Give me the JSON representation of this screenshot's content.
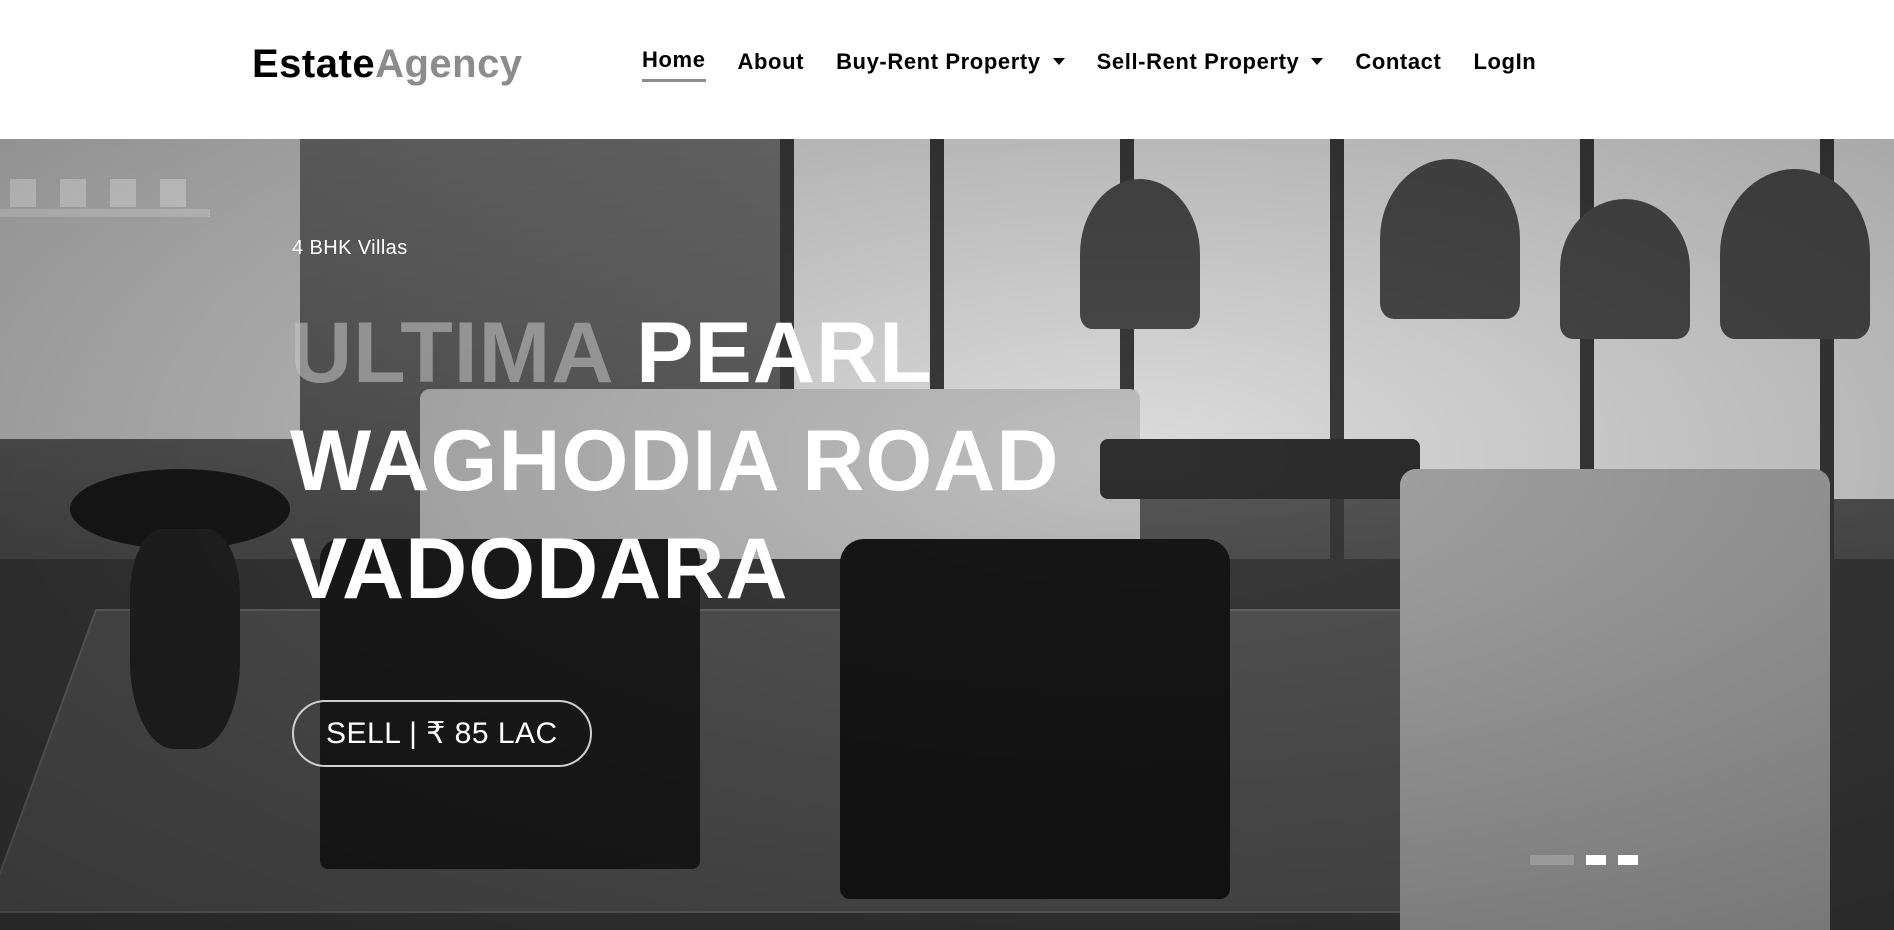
{
  "brand": {
    "part1": "Estate",
    "part2": "Agency"
  },
  "nav": {
    "items": [
      {
        "label": "Home",
        "active": true,
        "dropdown": false
      },
      {
        "label": "About",
        "active": false,
        "dropdown": false
      },
      {
        "label": "Buy-Rent Property",
        "active": false,
        "dropdown": true
      },
      {
        "label": "Sell-Rent Property",
        "active": false,
        "dropdown": true
      },
      {
        "label": "Contact",
        "active": false,
        "dropdown": false
      },
      {
        "label": "LogIn",
        "active": false,
        "dropdown": false
      }
    ]
  },
  "hero": {
    "subtitle": "4 BHK Villas",
    "title_dim": "ULTIMA",
    "title_line1_rest": " PEARL",
    "title_line2": "WAGHODIA ROAD",
    "title_line3": "VADODARA",
    "price_label": "SELL | ₹ 85 LAC",
    "slides_count": 3,
    "active_slide": 1
  },
  "colors": {
    "brand_dark": "#000000",
    "brand_grey": "#8c8c8c",
    "hero_text": "#ffffff",
    "indicator_active": "#9a9a9a"
  },
  "icons": {
    "dropdown": "caret-down-icon"
  }
}
